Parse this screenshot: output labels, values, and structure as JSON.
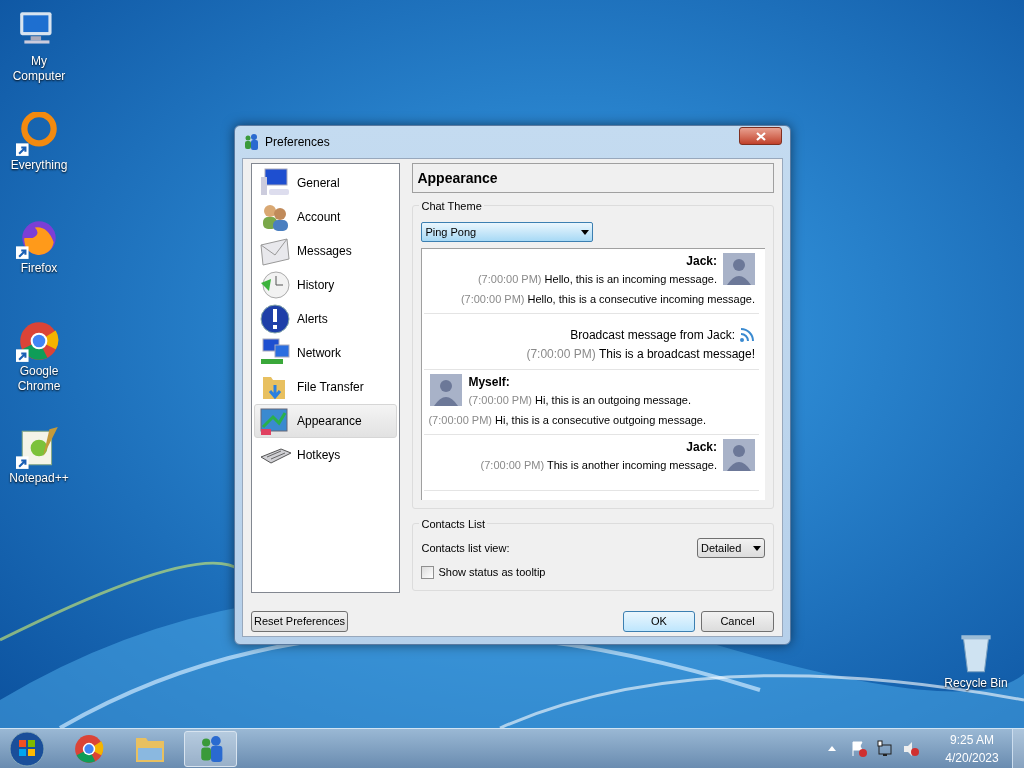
{
  "desktop_icons": [
    {
      "label": "My Computer"
    },
    {
      "label": "Everything"
    },
    {
      "label": "Firefox"
    },
    {
      "label": "Google Chrome"
    },
    {
      "label": "Notepad++"
    },
    {
      "label": "Recycle Bin"
    }
  ],
  "window": {
    "title": "Preferences"
  },
  "sidebar": {
    "items": [
      {
        "label": "General",
        "selected": false
      },
      {
        "label": "Account",
        "selected": false
      },
      {
        "label": "Messages",
        "selected": false
      },
      {
        "label": "History",
        "selected": false
      },
      {
        "label": "Alerts",
        "selected": false
      },
      {
        "label": "Network",
        "selected": false
      },
      {
        "label": "File Transfer",
        "selected": false
      },
      {
        "label": "Appearance",
        "selected": true
      },
      {
        "label": "Hotkeys",
        "selected": false
      }
    ]
  },
  "header": "Appearance",
  "chat_theme": {
    "legend": "Chat Theme",
    "value": "Ping Pong",
    "messages": [
      {
        "kind": "incoming",
        "sender": "Jack:",
        "lines": [
          {
            "time": "(7:00:00 PM)",
            "text": "Hello, this is an incoming message."
          },
          {
            "time": "(7:00:00 PM)",
            "text": "Hello, this is a consecutive incoming message."
          }
        ]
      },
      {
        "kind": "broadcast",
        "sender": "Broadcast message from Jack:",
        "lines": [
          {
            "time": "(7:00:00 PM)",
            "text": "This is a broadcast message!"
          }
        ]
      },
      {
        "kind": "outgoing",
        "sender": "Myself:",
        "lines": [
          {
            "time": "(7:00:00 PM)",
            "text": "Hi, this is an outgoing message."
          },
          {
            "time": "(7:00:00 PM)",
            "text": "Hi, this is a consecutive outgoing message."
          }
        ]
      },
      {
        "kind": "incoming",
        "sender": "Jack:",
        "lines": [
          {
            "time": "(7:00:00 PM)",
            "text": "This is another incoming message."
          }
        ]
      }
    ]
  },
  "contacts_list": {
    "legend": "Contacts List",
    "view_label": "Contacts list view:",
    "view_value": "Detailed",
    "tooltip_label": "Show status as tooltip",
    "tooltip_checked": false
  },
  "buttons": {
    "reset": "Reset Preferences",
    "ok": "OK",
    "cancel": "Cancel"
  },
  "tray": {
    "time": "9:25 AM",
    "date": "4/20/2023"
  }
}
